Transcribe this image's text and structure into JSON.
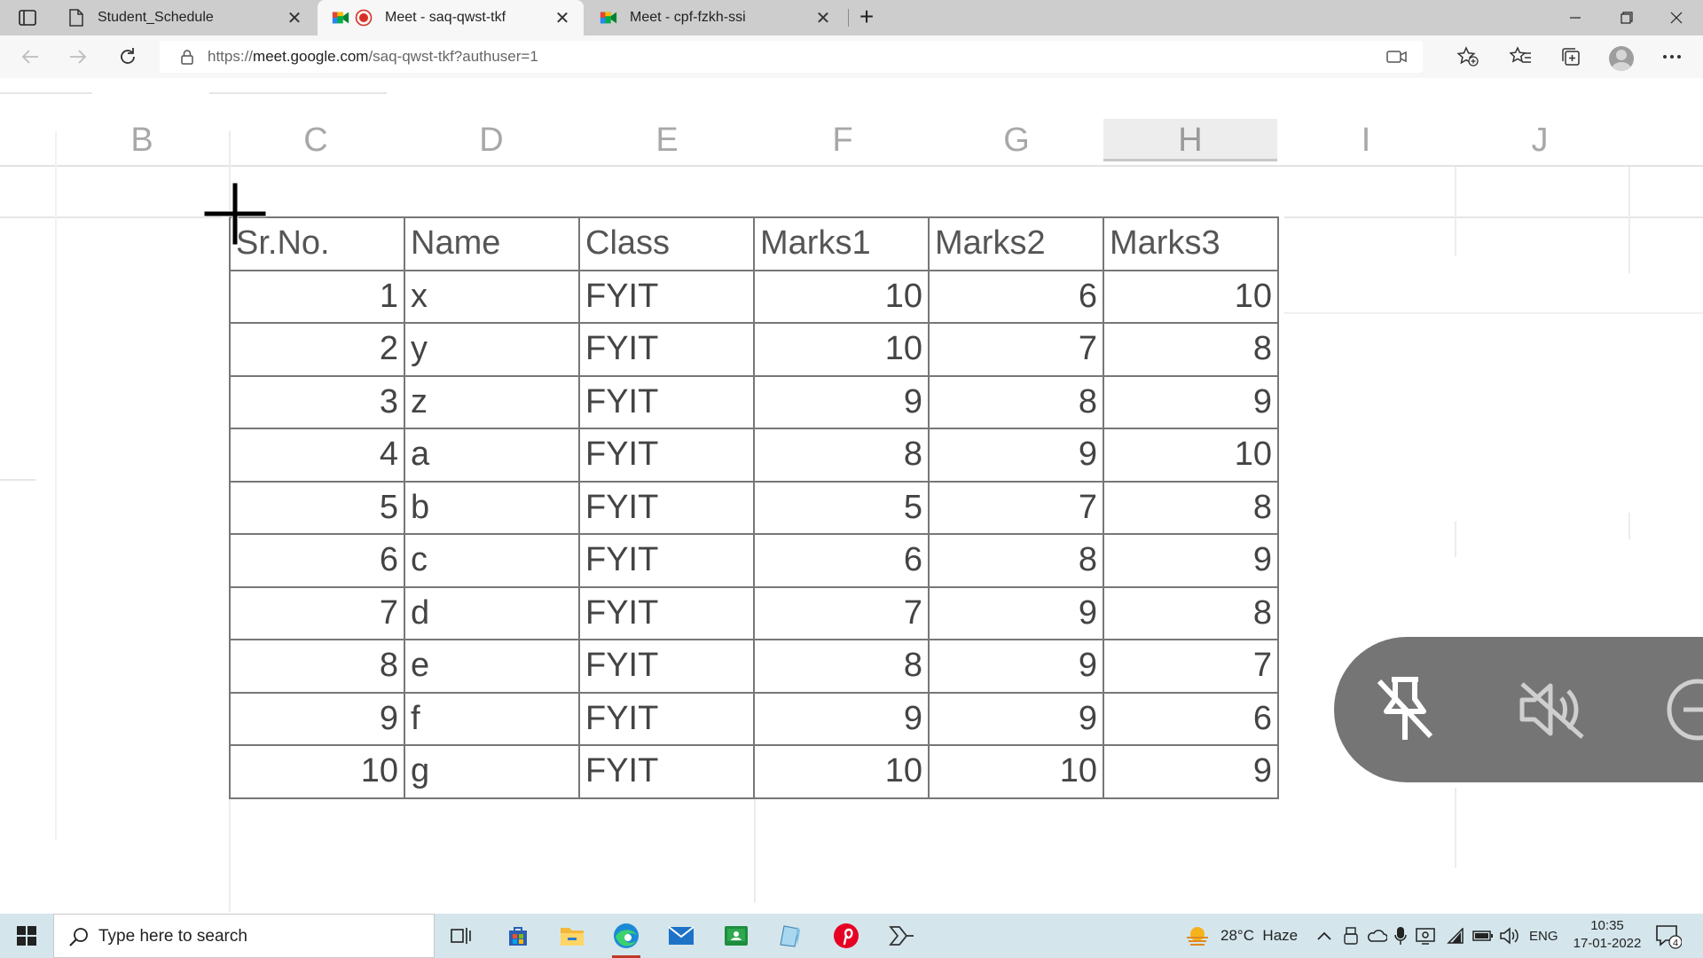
{
  "browser": {
    "tabs": [
      {
        "title": "Student_Schedule",
        "active": false
      },
      {
        "title": "Meet - saq-qwst-tkf",
        "active": true
      },
      {
        "title": "Meet - cpf-fzkh-ssi",
        "active": false
      }
    ],
    "url_prefix": "https://",
    "url_domain": "meet.google.com",
    "url_path": "/saq-qwst-tkf?authuser=1"
  },
  "sheet": {
    "columns": [
      "B",
      "C",
      "D",
      "E",
      "F",
      "G",
      "H",
      "I",
      "J"
    ],
    "selected_column": "H",
    "headers": [
      "Sr.No.",
      "Name",
      "Class",
      "Marks1",
      "Marks2",
      "Marks3"
    ],
    "rows": [
      [
        "1",
        "x",
        "FYIT",
        "10",
        "6",
        "10"
      ],
      [
        "2",
        "y",
        "FYIT",
        "10",
        "7",
        "8"
      ],
      [
        "3",
        "z",
        "FYIT",
        "9",
        "8",
        "9"
      ],
      [
        "4",
        "a",
        "FYIT",
        "8",
        "9",
        "10"
      ],
      [
        "5",
        "b",
        "FYIT",
        "5",
        "7",
        "8"
      ],
      [
        "6",
        "c",
        "FYIT",
        "6",
        "8",
        "9"
      ],
      [
        "7",
        "d",
        "FYIT",
        "7",
        "9",
        "8"
      ],
      [
        "8",
        "e",
        "FYIT",
        "8",
        "9",
        "7"
      ],
      [
        "9",
        "f",
        "FYIT",
        "9",
        "9",
        "6"
      ],
      [
        "10",
        "g",
        "FYIT",
        "10",
        "10",
        "9"
      ]
    ]
  },
  "meet_controls": {
    "icons": [
      "unpin-icon",
      "mute-icon",
      "minus-circle-icon"
    ]
  },
  "taskbar": {
    "search_placeholder": "Type here to search",
    "weather": "28°C  Haze",
    "language": "ENG",
    "time": "10:35",
    "date": "17-01-2022",
    "notification_count": "4"
  }
}
